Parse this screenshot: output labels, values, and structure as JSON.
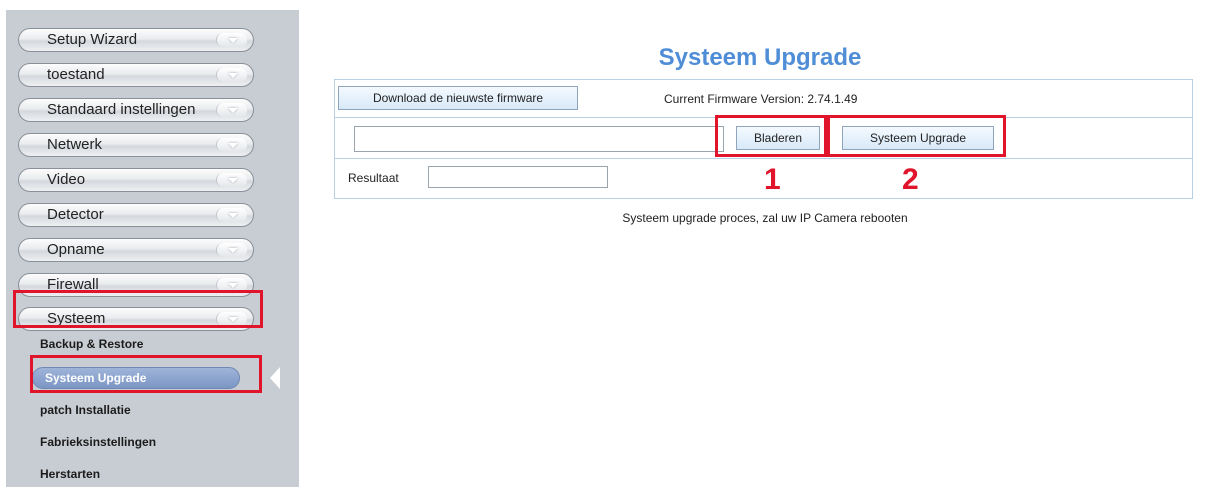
{
  "sidebar": {
    "menu": [
      {
        "label": "Setup Wizard"
      },
      {
        "label": "toestand"
      },
      {
        "label": "Standaard instellingen"
      },
      {
        "label": "Netwerk"
      },
      {
        "label": "Video"
      },
      {
        "label": "Detector"
      },
      {
        "label": "Opname"
      },
      {
        "label": "Firewall"
      },
      {
        "label": "Systeem"
      }
    ],
    "sub_items": [
      {
        "label": "Backup & Restore"
      },
      {
        "label": "Systeem Upgrade"
      },
      {
        "label": "patch Installatie"
      },
      {
        "label": "Fabrieksinstellingen"
      },
      {
        "label": "Herstarten"
      }
    ]
  },
  "main": {
    "title": "Systeem Upgrade",
    "download_button": "Download de nieuwste firmware",
    "firmware_version_text": "Current Firmware Version: 2.74.1.49",
    "file_input_value": "",
    "browse_button": "Bladeren",
    "upgrade_button": "Systeem Upgrade",
    "result_label": "Resultaat",
    "result_value": "",
    "note": "Systeem upgrade proces, zal uw IP Camera rebooten"
  },
  "annotations": {
    "step1": "1",
    "step2": "2",
    "highlight_color": "#e0142a"
  }
}
